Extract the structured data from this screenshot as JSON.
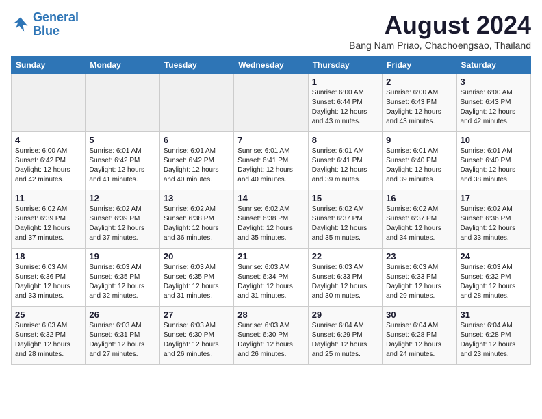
{
  "header": {
    "logo_line1": "General",
    "logo_line2": "Blue",
    "month": "August 2024",
    "location": "Bang Nam Priao, Chachoengsao, Thailand"
  },
  "weekdays": [
    "Sunday",
    "Monday",
    "Tuesday",
    "Wednesday",
    "Thursday",
    "Friday",
    "Saturday"
  ],
  "weeks": [
    [
      {
        "day": "",
        "info": ""
      },
      {
        "day": "",
        "info": ""
      },
      {
        "day": "",
        "info": ""
      },
      {
        "day": "",
        "info": ""
      },
      {
        "day": "1",
        "info": "Sunrise: 6:00 AM\nSunset: 6:44 PM\nDaylight: 12 hours\nand 43 minutes."
      },
      {
        "day": "2",
        "info": "Sunrise: 6:00 AM\nSunset: 6:43 PM\nDaylight: 12 hours\nand 43 minutes."
      },
      {
        "day": "3",
        "info": "Sunrise: 6:00 AM\nSunset: 6:43 PM\nDaylight: 12 hours\nand 42 minutes."
      }
    ],
    [
      {
        "day": "4",
        "info": "Sunrise: 6:00 AM\nSunset: 6:42 PM\nDaylight: 12 hours\nand 42 minutes."
      },
      {
        "day": "5",
        "info": "Sunrise: 6:01 AM\nSunset: 6:42 PM\nDaylight: 12 hours\nand 41 minutes."
      },
      {
        "day": "6",
        "info": "Sunrise: 6:01 AM\nSunset: 6:42 PM\nDaylight: 12 hours\nand 40 minutes."
      },
      {
        "day": "7",
        "info": "Sunrise: 6:01 AM\nSunset: 6:41 PM\nDaylight: 12 hours\nand 40 minutes."
      },
      {
        "day": "8",
        "info": "Sunrise: 6:01 AM\nSunset: 6:41 PM\nDaylight: 12 hours\nand 39 minutes."
      },
      {
        "day": "9",
        "info": "Sunrise: 6:01 AM\nSunset: 6:40 PM\nDaylight: 12 hours\nand 39 minutes."
      },
      {
        "day": "10",
        "info": "Sunrise: 6:01 AM\nSunset: 6:40 PM\nDaylight: 12 hours\nand 38 minutes."
      }
    ],
    [
      {
        "day": "11",
        "info": "Sunrise: 6:02 AM\nSunset: 6:39 PM\nDaylight: 12 hours\nand 37 minutes."
      },
      {
        "day": "12",
        "info": "Sunrise: 6:02 AM\nSunset: 6:39 PM\nDaylight: 12 hours\nand 37 minutes."
      },
      {
        "day": "13",
        "info": "Sunrise: 6:02 AM\nSunset: 6:38 PM\nDaylight: 12 hours\nand 36 minutes."
      },
      {
        "day": "14",
        "info": "Sunrise: 6:02 AM\nSunset: 6:38 PM\nDaylight: 12 hours\nand 35 minutes."
      },
      {
        "day": "15",
        "info": "Sunrise: 6:02 AM\nSunset: 6:37 PM\nDaylight: 12 hours\nand 35 minutes."
      },
      {
        "day": "16",
        "info": "Sunrise: 6:02 AM\nSunset: 6:37 PM\nDaylight: 12 hours\nand 34 minutes."
      },
      {
        "day": "17",
        "info": "Sunrise: 6:02 AM\nSunset: 6:36 PM\nDaylight: 12 hours\nand 33 minutes."
      }
    ],
    [
      {
        "day": "18",
        "info": "Sunrise: 6:03 AM\nSunset: 6:36 PM\nDaylight: 12 hours\nand 33 minutes."
      },
      {
        "day": "19",
        "info": "Sunrise: 6:03 AM\nSunset: 6:35 PM\nDaylight: 12 hours\nand 32 minutes."
      },
      {
        "day": "20",
        "info": "Sunrise: 6:03 AM\nSunset: 6:35 PM\nDaylight: 12 hours\nand 31 minutes."
      },
      {
        "day": "21",
        "info": "Sunrise: 6:03 AM\nSunset: 6:34 PM\nDaylight: 12 hours\nand 31 minutes."
      },
      {
        "day": "22",
        "info": "Sunrise: 6:03 AM\nSunset: 6:33 PM\nDaylight: 12 hours\nand 30 minutes."
      },
      {
        "day": "23",
        "info": "Sunrise: 6:03 AM\nSunset: 6:33 PM\nDaylight: 12 hours\nand 29 minutes."
      },
      {
        "day": "24",
        "info": "Sunrise: 6:03 AM\nSunset: 6:32 PM\nDaylight: 12 hours\nand 28 minutes."
      }
    ],
    [
      {
        "day": "25",
        "info": "Sunrise: 6:03 AM\nSunset: 6:32 PM\nDaylight: 12 hours\nand 28 minutes."
      },
      {
        "day": "26",
        "info": "Sunrise: 6:03 AM\nSunset: 6:31 PM\nDaylight: 12 hours\nand 27 minutes."
      },
      {
        "day": "27",
        "info": "Sunrise: 6:03 AM\nSunset: 6:30 PM\nDaylight: 12 hours\nand 26 minutes."
      },
      {
        "day": "28",
        "info": "Sunrise: 6:03 AM\nSunset: 6:30 PM\nDaylight: 12 hours\nand 26 minutes."
      },
      {
        "day": "29",
        "info": "Sunrise: 6:04 AM\nSunset: 6:29 PM\nDaylight: 12 hours\nand 25 minutes."
      },
      {
        "day": "30",
        "info": "Sunrise: 6:04 AM\nSunset: 6:28 PM\nDaylight: 12 hours\nand 24 minutes."
      },
      {
        "day": "31",
        "info": "Sunrise: 6:04 AM\nSunset: 6:28 PM\nDaylight: 12 hours\nand 23 minutes."
      }
    ]
  ]
}
